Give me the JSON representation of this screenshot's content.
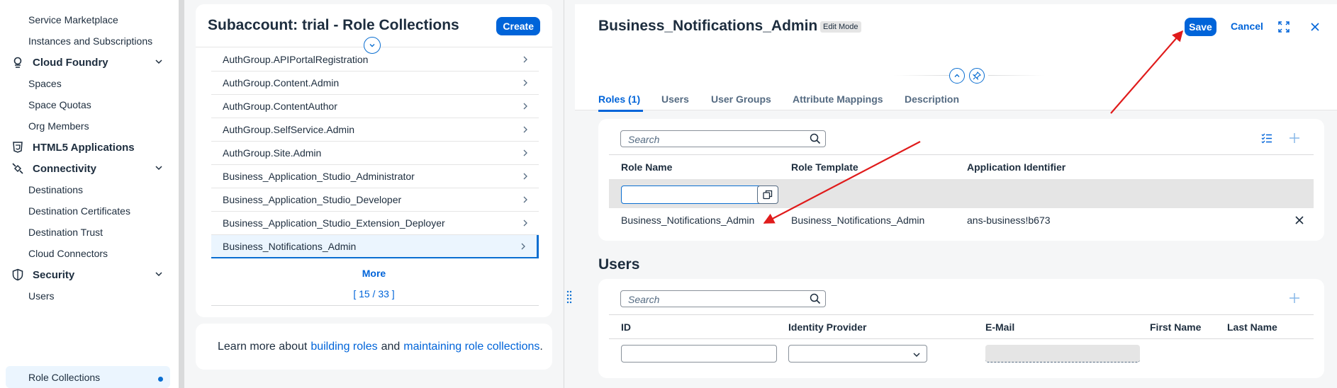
{
  "nav": {
    "items": [
      {
        "label": "Service Marketplace",
        "type": "sub"
      },
      {
        "label": "Instances and Subscriptions",
        "type": "sub"
      },
      {
        "label": "Cloud Foundry",
        "type": "group",
        "icon": "cloud-foundry-icon"
      },
      {
        "label": "Spaces",
        "type": "sub"
      },
      {
        "label": "Space Quotas",
        "type": "sub"
      },
      {
        "label": "Org Members",
        "type": "sub"
      },
      {
        "label": "HTML5 Applications",
        "type": "group",
        "icon": "html5-icon"
      },
      {
        "label": "Connectivity",
        "type": "group",
        "icon": "connectivity-icon"
      },
      {
        "label": "Destinations",
        "type": "sub"
      },
      {
        "label": "Destination Certificates",
        "type": "sub"
      },
      {
        "label": "Destination Trust",
        "type": "sub"
      },
      {
        "label": "Cloud Connectors",
        "type": "sub"
      },
      {
        "label": "Security",
        "type": "group",
        "icon": "shield-icon"
      },
      {
        "label": "Users",
        "type": "sub"
      },
      {
        "label": "Role Collections",
        "type": "sub",
        "selected": true
      }
    ]
  },
  "middle": {
    "title": "Subaccount: trial - Role Collections",
    "create_label": "Create",
    "rows": [
      "AuthGroup.APIPortalRegistration",
      "AuthGroup.Content.Admin",
      "AuthGroup.ContentAuthor",
      "AuthGroup.SelfService.Admin",
      "AuthGroup.Site.Admin",
      "Business_Application_Studio_Administrator",
      "Business_Application_Studio_Developer",
      "Business_Application_Studio_Extension_Deployer",
      "Business_Notifications_Admin"
    ],
    "more_label": "More",
    "count_label": "[ 15 / 33 ]",
    "learn": {
      "prefix": "Learn more about",
      "link1": "building roles",
      "middle": "and",
      "link2": "maintaining role collections",
      "suffix": "."
    }
  },
  "detail": {
    "title": "Business_Notifications_Admin",
    "mode_badge": "Edit Mode",
    "save_label": "Save",
    "cancel_label": "Cancel",
    "tabs": [
      "Roles (1)",
      "Users",
      "User Groups",
      "Attribute Mappings",
      "Description"
    ],
    "roles": {
      "search_placeholder": "Search",
      "columns": [
        "Role Name",
        "Role Template",
        "Application Identifier"
      ],
      "rows": [
        {
          "role_name": "Business_Notifications_Admin",
          "role_template": "Business_Notifications_Admin",
          "app_id": "ans-business!b673"
        }
      ]
    },
    "users": {
      "title": "Users",
      "search_placeholder": "Search",
      "columns": [
        "ID",
        "Identity Provider",
        "E-Mail",
        "First Name",
        "Last Name"
      ]
    }
  },
  "colors": {
    "accent": "#0064d9",
    "annotation_arrow": "#e01b1b",
    "selected_bg": "#ebf5fe"
  }
}
